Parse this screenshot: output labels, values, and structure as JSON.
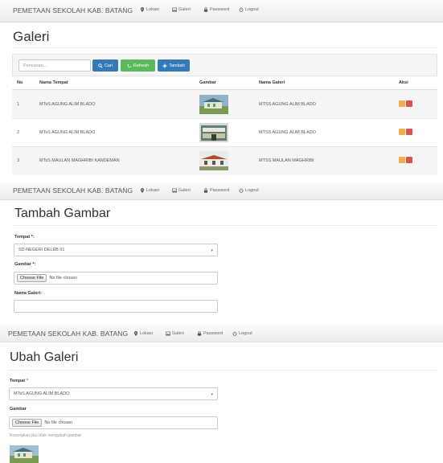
{
  "navbar": {
    "brand": "PEMETAAN SEKOLAH KAB. BATANG",
    "items": [
      {
        "label": "Lokasi",
        "icon": "map-marker-icon"
      },
      {
        "label": "Galeri",
        "icon": "image-icon"
      },
      {
        "label": "Password",
        "icon": "lock-icon"
      },
      {
        "label": "Logout",
        "icon": "power-icon"
      }
    ]
  },
  "galeri": {
    "title": "Galeri",
    "search_placeholder": "Pencarian...",
    "cari_label": "Cari",
    "refresh_label": "Refresh",
    "tambah_label": "Tambah",
    "columns": [
      "No",
      "Nama Tempat",
      "Gambar",
      "Nama Galeri",
      "Aksi"
    ],
    "rows": [
      {
        "no": "1",
        "nama_tempat": "MTsS AGUNG ALIM BLADO",
        "gambar": "building-photo",
        "nama_galeri": "MTSS AGUNG ALIM BLADO"
      },
      {
        "no": "2",
        "nama_tempat": "MTsS AGUNG ALIM BLADO",
        "gambar": "building-photo",
        "nama_galeri": "MTSS AGUNG ALIM BLADO"
      },
      {
        "no": "3",
        "nama_tempat": "MTsS MAULAN MAGHRIBI KANDEMAN",
        "gambar": "building-photo",
        "nama_galeri": "MTSS MAULAN MAGHRIBI"
      }
    ]
  },
  "tambah": {
    "title": "Tambah Gambar",
    "tempat_label": "Tempat *:",
    "tempat_value": "SD NEGERI DELEB 01",
    "gambar_label": "Gambar *:",
    "choose_file": "Choose File",
    "no_file": "No file chosen",
    "nama_label": "Nama Galeri:",
    "nama_value": ""
  },
  "ubah": {
    "title": "Ubah Galeri",
    "tempat_label": "Tempat",
    "required_mark": "*",
    "tempat_value": "MTsS AGUNG ALIM BLADO",
    "gambar_label": "Gambar",
    "choose_file": "Choose File",
    "no_file": "No file chosen",
    "hint": "Kosongkan jika tidak mengubah gambar"
  },
  "colors": {
    "primary": "#337ab7",
    "success": "#5cb85c",
    "warning": "#f0ad4e",
    "danger": "#d9534f"
  }
}
